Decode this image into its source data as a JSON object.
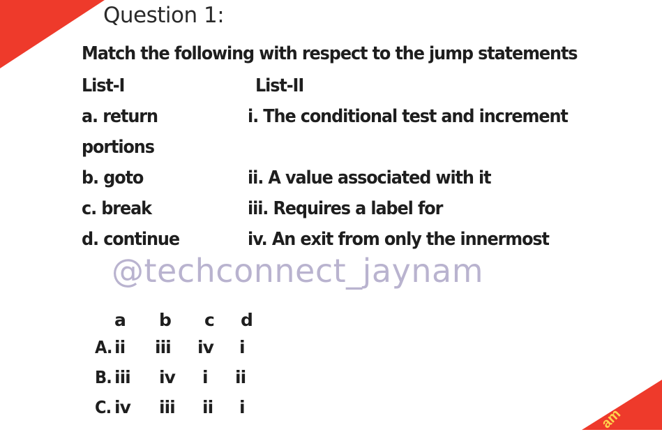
{
  "decor": {
    "corner_text": "am",
    "accent": "#ee3a2b"
  },
  "question": {
    "header": "Question 1:",
    "prompt": "Match the following with respect to the jump statements",
    "list1_heading": "List-I",
    "list2_heading": "List-II",
    "rows": [
      {
        "left": "a. return",
        "right": "i.  The conditional test and increment"
      },
      {
        "left": "portions",
        "right": ""
      },
      {
        "left": "b. goto",
        "right": "ii.  A value associated with it"
      },
      {
        "left": "c. break",
        "right": "iii. Requires a label for"
      },
      {
        "left": "d. continue",
        "right": "iv. An exit from only the innermost"
      }
    ]
  },
  "watermark": "@techconnect_jaynam",
  "options": {
    "headers": [
      "a",
      "b",
      "c",
      "d"
    ],
    "rows": [
      {
        "label": "A.",
        "values": [
          "ii",
          "iii",
          "iv",
          "i"
        ]
      },
      {
        "label": "B.",
        "values": [
          "iii",
          "iv",
          "i",
          "ii"
        ]
      },
      {
        "label": "C.",
        "values": [
          "iv",
          "iii",
          "ii",
          "i"
        ]
      }
    ]
  }
}
